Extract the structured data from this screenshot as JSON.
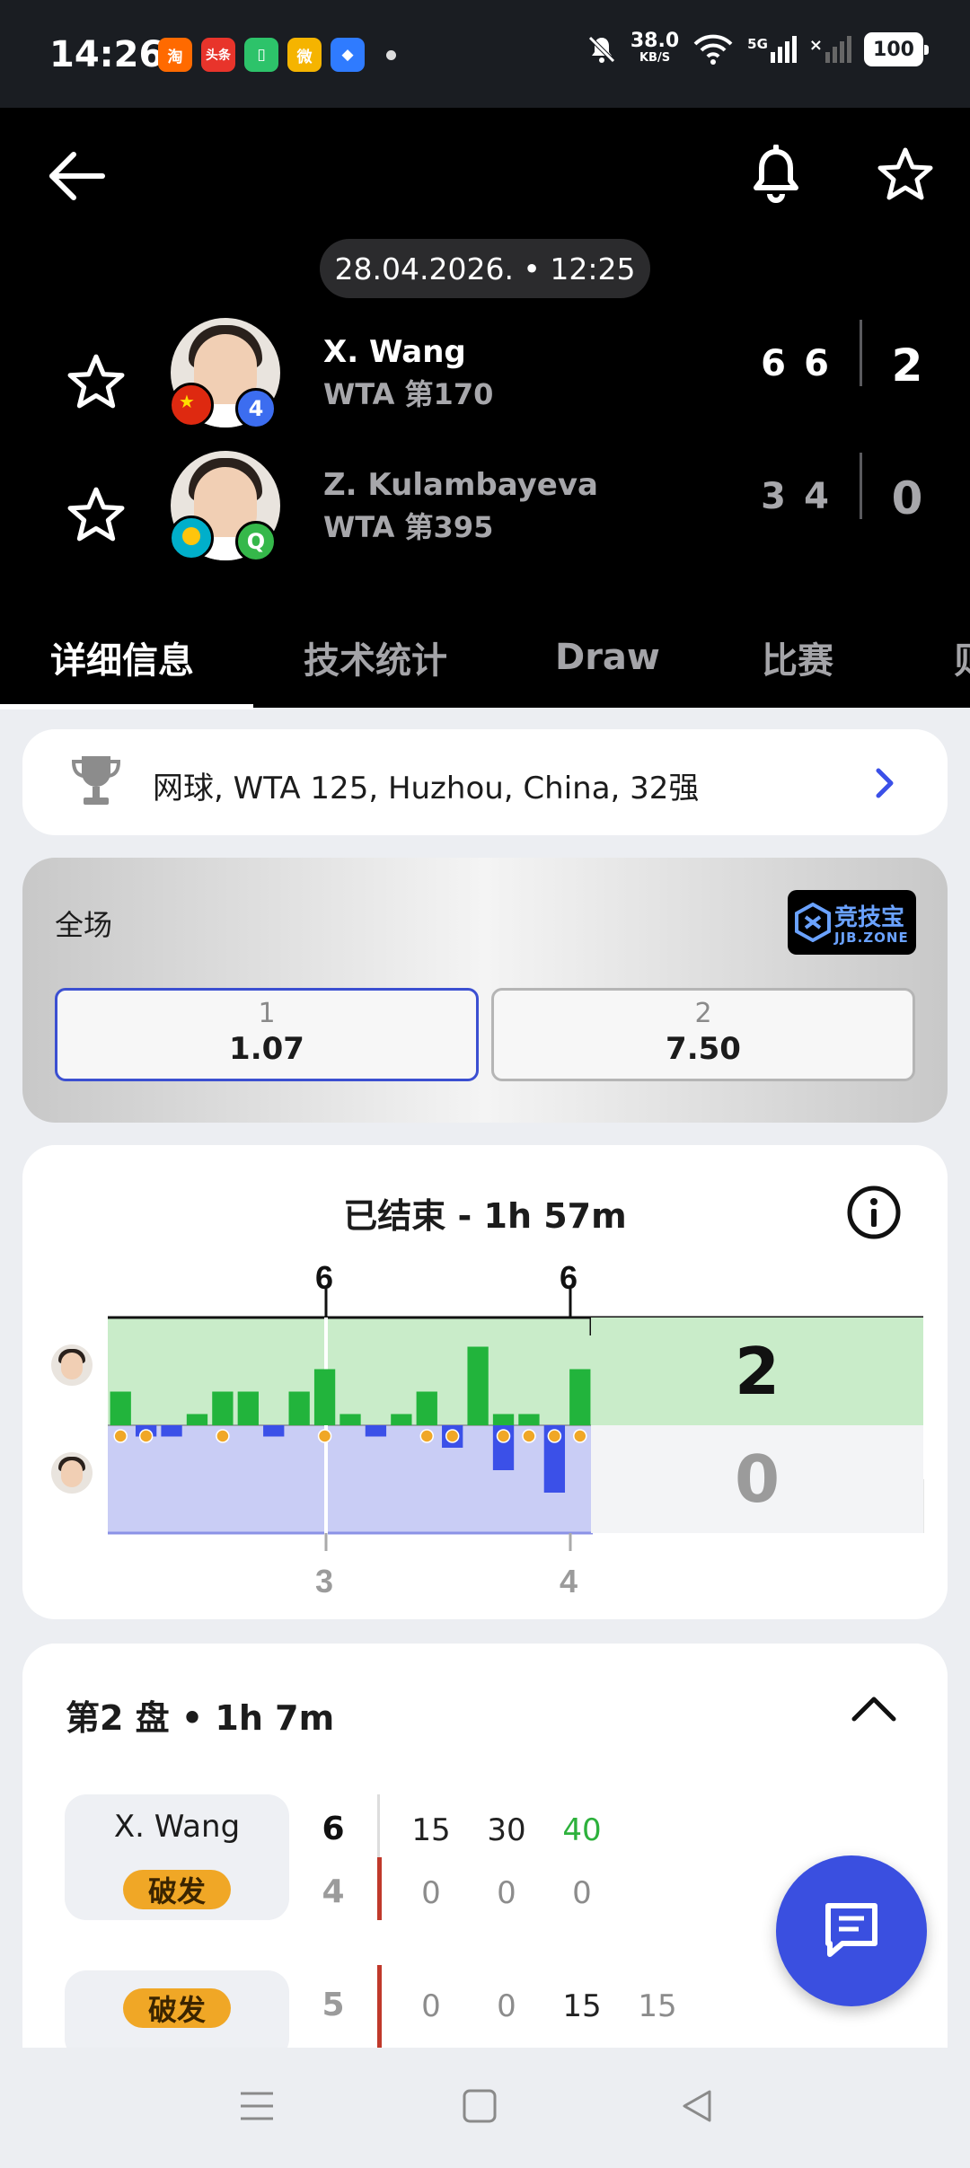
{
  "status_bar": {
    "time": "14:26",
    "apps": [
      {
        "label": "淘",
        "color": "#ff6a00"
      },
      {
        "label": "头条",
        "color": "#e8342b"
      },
      {
        "label": "▯",
        "color": "#2dc36a"
      },
      {
        "label": "微",
        "color": "#f5b400"
      },
      {
        "label": "◆",
        "color": "#2f7bff"
      }
    ],
    "net_speed": "38.0",
    "net_unit": "KB/S",
    "network": "5G",
    "battery": "100"
  },
  "header": {
    "datetime": "28.04.2026. • 12:25",
    "players": [
      {
        "name": "X. Wang",
        "rank": "WTA 第170",
        "badge": "4",
        "badge_color": "#3c6df0",
        "flag": "china",
        "sets": [
          "6",
          "6"
        ],
        "total": "2",
        "winner": true
      },
      {
        "name": "Z. Kulambayeva",
        "rank": "WTA 第395",
        "badge": "Q",
        "badge_color": "#35b84a",
        "flag": "kazakhstan",
        "sets": [
          "3",
          "4"
        ],
        "total": "0",
        "winner": false
      }
    ],
    "tabs": [
      "详细信息",
      "技术统计",
      "Draw",
      "比赛",
      "则"
    ],
    "active_tab": 0
  },
  "competition": {
    "text": "网球, WTA 125, Huzhou, China, 32强"
  },
  "odds": {
    "title": "全场",
    "brand_name": "竞技宝",
    "brand_sub": "JJB.ZONE",
    "options": [
      {
        "label": "1",
        "value": "1.07",
        "selected": true
      },
      {
        "label": "2",
        "value": "7.50",
        "selected": false
      }
    ]
  },
  "match_status": {
    "title": "已结束 - 1h 57m",
    "set1_top": "6",
    "set2_top": "6",
    "set1_bottom": "3",
    "set2_bottom": "4",
    "total_p1": "2",
    "total_p2": "0"
  },
  "chart_data": {
    "type": "bar",
    "title": "",
    "series": [
      {
        "name": "X. Wang",
        "color": "#22b43c",
        "values": [
          3,
          0,
          0,
          1,
          3,
          3,
          0,
          3,
          5,
          1,
          0,
          1,
          3,
          0,
          7,
          1,
          1,
          0,
          5
        ]
      },
      {
        "name": "Z. Kulambayeva",
        "color": "#3b50e8",
        "values": [
          0,
          1,
          1,
          0,
          0,
          0,
          1,
          0,
          0,
          0,
          1,
          0,
          0,
          2,
          0,
          4,
          0,
          6,
          0
        ]
      }
    ],
    "set_boundaries_after_game": [
      9
    ],
    "break_markers": [
      0,
      1,
      4,
      8,
      12,
      13,
      15,
      16,
      17,
      18
    ]
  },
  "set_detail": {
    "title": "第2 盘 • 1h 7m",
    "player_name": "X. Wang",
    "break_label": "破发",
    "rows": [
      {
        "games_top": "6",
        "games_bottom": "4",
        "top_points": [
          "15",
          "30",
          "40"
        ],
        "bottom_points": [
          "0",
          "0",
          "0"
        ]
      },
      {
        "games": "5",
        "points": [
          "0",
          "0",
          "15",
          "15"
        ]
      }
    ]
  }
}
